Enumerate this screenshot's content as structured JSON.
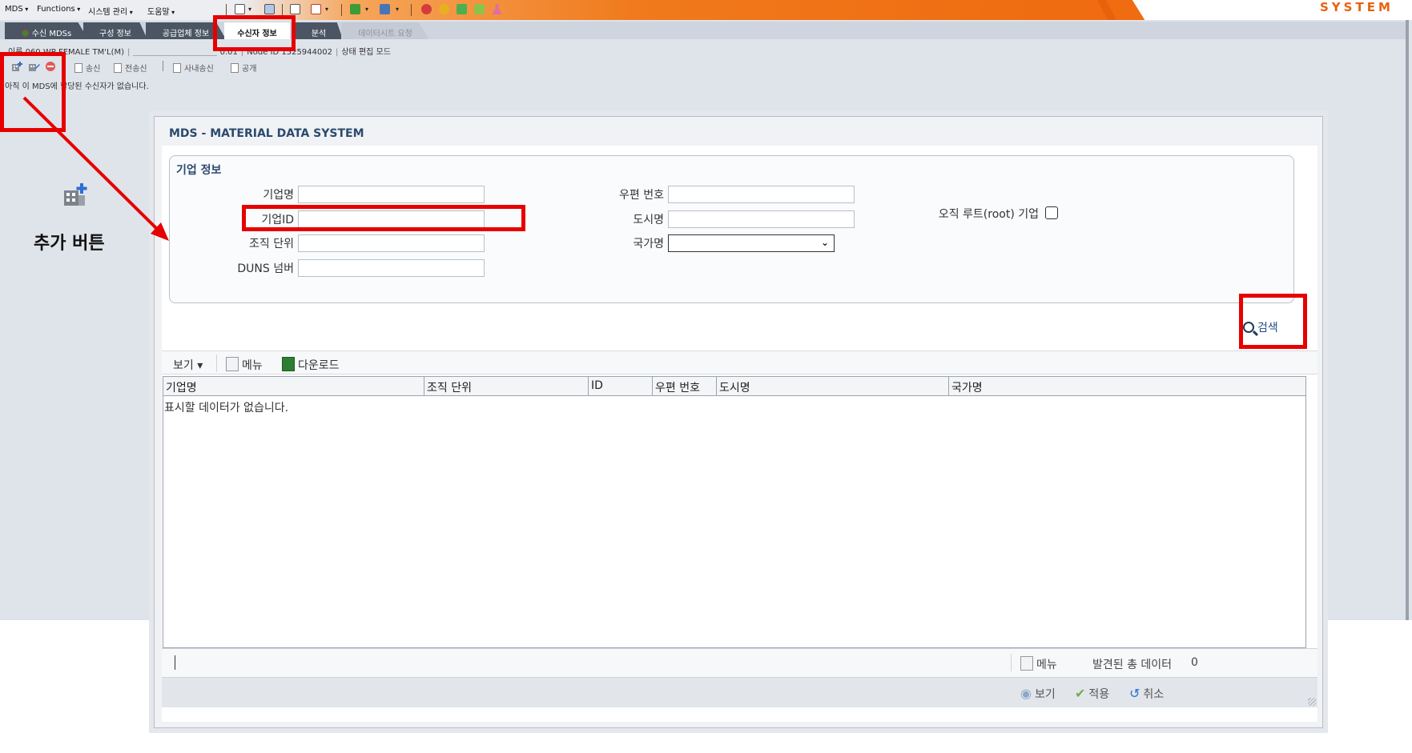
{
  "menubar": {
    "items": [
      "MDS",
      "Functions",
      "시스템 관리",
      "도움말"
    ],
    "brand": "SYSTEM"
  },
  "tabs": [
    {
      "label": "수신 MDSs",
      "state": "normal"
    },
    {
      "label": "구성 정보",
      "state": "normal"
    },
    {
      "label": "공급업체 정보",
      "state": "normal"
    },
    {
      "label": "수신자 정보",
      "state": "active"
    },
    {
      "label": "분석",
      "state": "normal"
    },
    {
      "label": "데이터시트 요청",
      "state": "disabled"
    }
  ],
  "infoline": {
    "name": "이름 060 WP FEMALE TM'L(M)",
    "version": "0.01",
    "node": "Node ID 1525944002",
    "status": "상태 편집 모드"
  },
  "actions": {
    "send": "송신",
    "forward": "전송신",
    "internal_send": "사내송신",
    "publish": "공개"
  },
  "notice": "아직 이 MDS에 할당된 수신자가 없습니다.",
  "annotation": {
    "caption": "추가 버튼"
  },
  "dialog": {
    "title": "MDS - MATERIAL DATA SYSTEM",
    "section_title": "기업 정보",
    "fields": {
      "company_name": {
        "label": "기업명",
        "value": ""
      },
      "company_id": {
        "label": "기업ID",
        "value": ""
      },
      "org_unit": {
        "label": "조직 단위",
        "value": ""
      },
      "duns": {
        "label": "DUNS 넘버",
        "value": ""
      },
      "postal_code": {
        "label": "우편 번호",
        "value": ""
      },
      "city": {
        "label": "도시명",
        "value": ""
      },
      "country": {
        "label": "국가명",
        "value": ""
      },
      "root_only": {
        "label": "오직 루트(root) 기업",
        "checked": false
      }
    },
    "search_label": "검색",
    "grid_toolbar": {
      "view": "보기",
      "menu": "메뉴",
      "download": "다운로드"
    },
    "columns": [
      "기업명",
      "조직 단위",
      "ID",
      "우편 번호",
      "도시명",
      "국가명"
    ],
    "empty_message": "표시할 데이터가 없습니다.",
    "footer": {
      "menu": "메뉴",
      "total": "발견된 총 데이터",
      "count": "0"
    },
    "buttons": {
      "view": "보기",
      "apply": "적용",
      "cancel": "취소"
    }
  },
  "colors": {
    "annotation_red": "#e60000",
    "title_blue": "#2b4a6e",
    "menubar_orange": "#ef6c10"
  }
}
